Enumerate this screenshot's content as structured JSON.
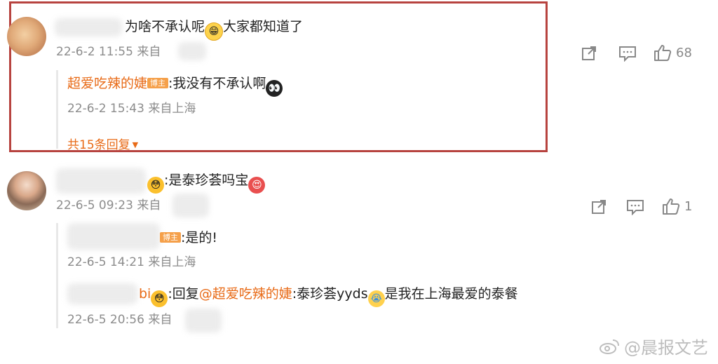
{
  "comment1": {
    "text": "为啥不承认呢",
    "text_after_emoji": "大家都知道了",
    "time": "22-6-2 11:55",
    "location": "来自",
    "like_count": "68",
    "reply": {
      "author": "超爱吃辣的婕",
      "badge": "博主",
      "text": ":我没有不承认啊",
      "time": "22-6-2 15:43",
      "location": "来自上海"
    },
    "more_replies": "共15条回复"
  },
  "comment2": {
    "text": ":是泰珍荟吗宝",
    "time": "22-6-5 09:23",
    "location": "来自",
    "like_count": "1",
    "reply1": {
      "badge": "博主",
      "text": ":是的!",
      "time": "22-6-5 14:21",
      "location": "来自上海"
    },
    "reply2": {
      "author_fragment": "bi",
      "text_prefix": ":回复",
      "mention": "@超爱吃辣的婕",
      "text_mid": ":泰珍荟yyds",
      "text_end": "是我在上海最爱的泰餐",
      "time": "22-6-5 20:56",
      "location": "来自"
    }
  },
  "watermark": "@晨报文艺"
}
